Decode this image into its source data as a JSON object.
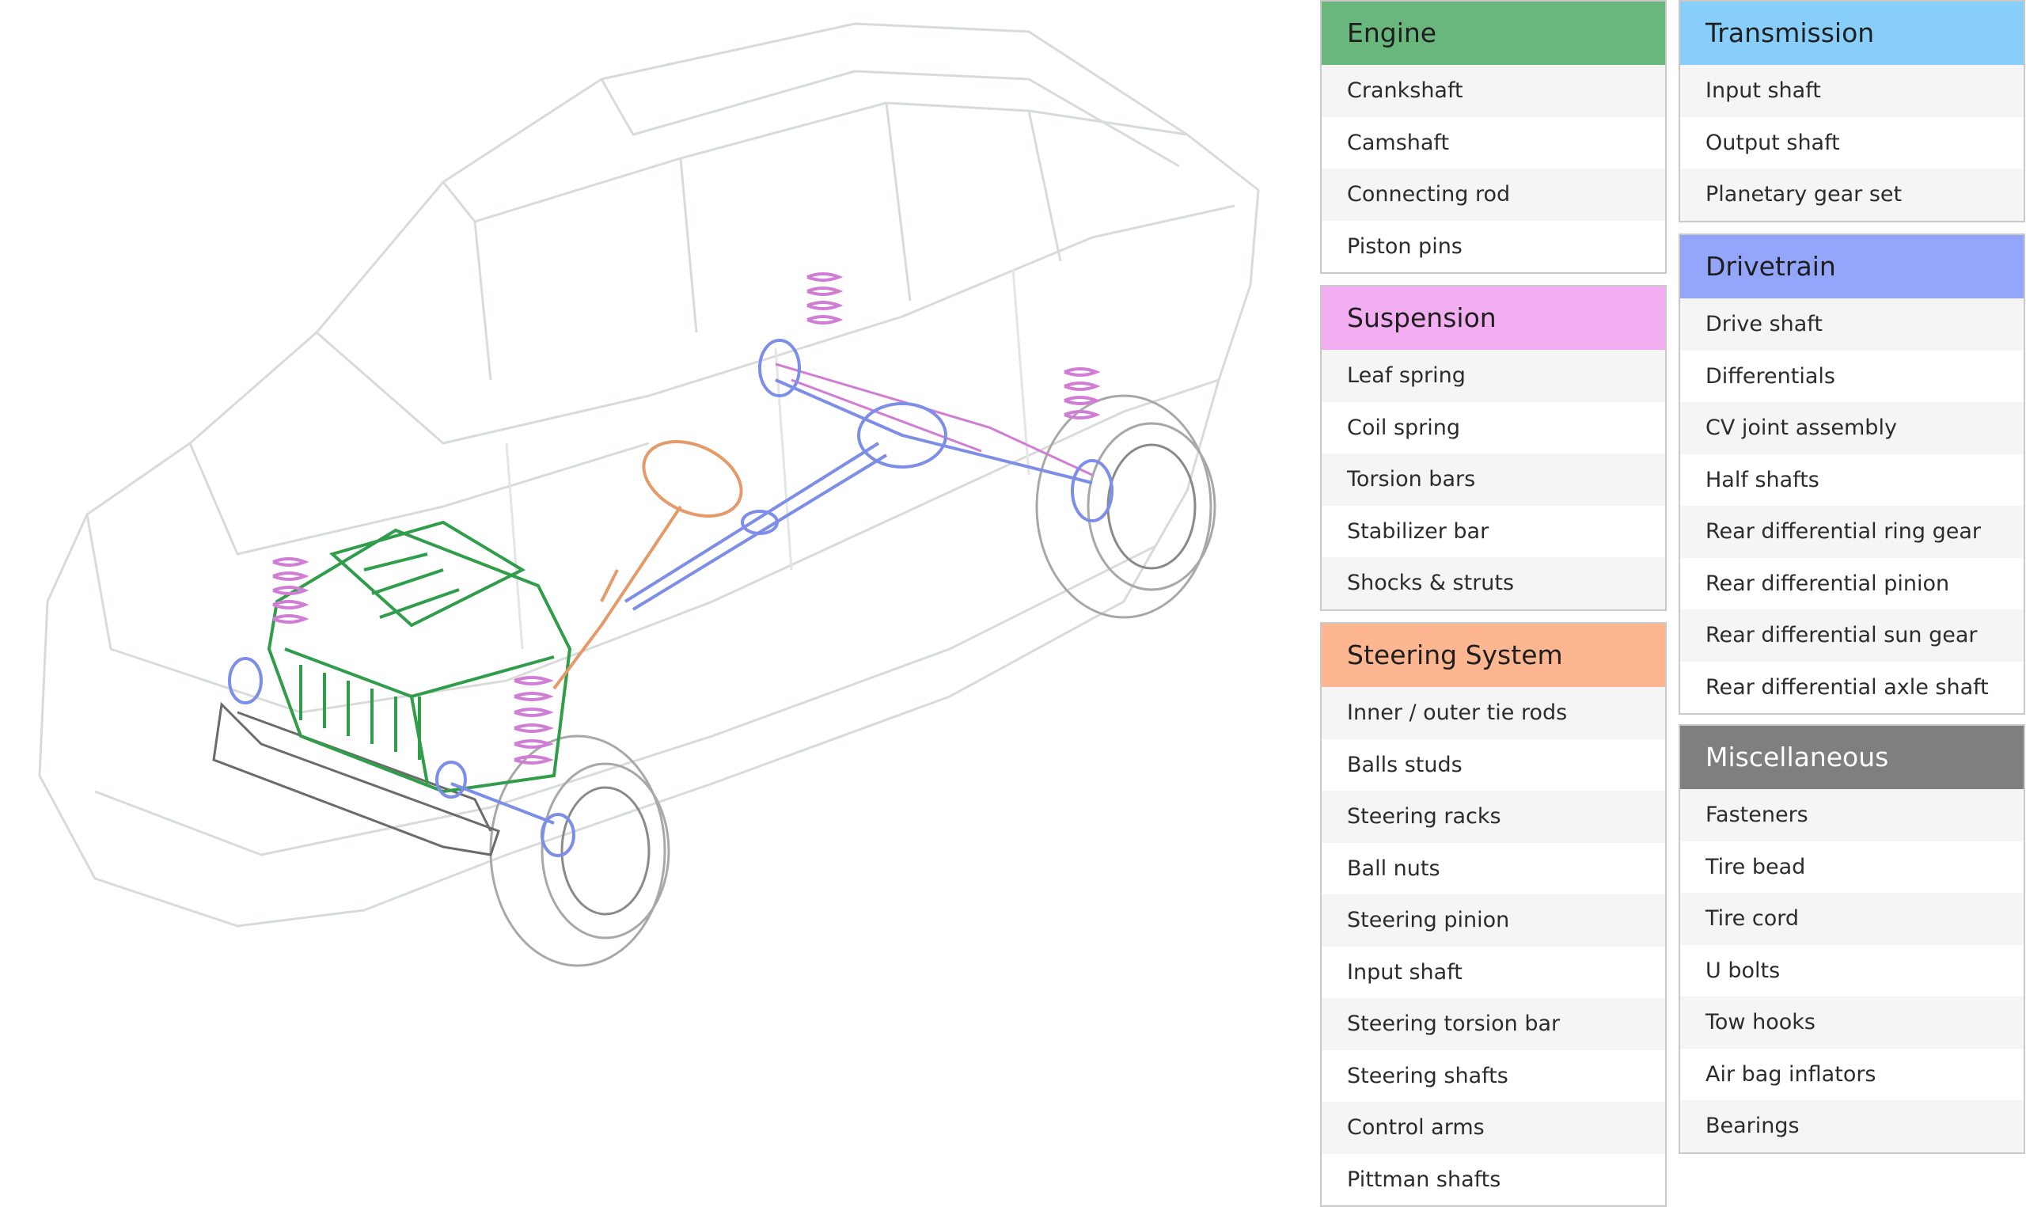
{
  "categories": {
    "engine": {
      "title": "Engine",
      "color": "#6ab77e",
      "items": [
        "Crankshaft",
        "Camshaft",
        "Connecting rod",
        "Piston pins"
      ]
    },
    "transmission": {
      "title": "Transmission",
      "color": "#87cffa",
      "items": [
        "Input shaft",
        "Output shaft",
        "Planetary gear set"
      ]
    },
    "suspension": {
      "title": "Suspension",
      "color": "#f3aef1",
      "items": [
        "Leaf spring",
        "Coil spring",
        "Torsion bars",
        "Stabilizer bar",
        "Shocks & struts"
      ]
    },
    "drivetrain": {
      "title": "Drivetrain",
      "color": "#93a6fb",
      "items": [
        "Drive shaft",
        "Differentials",
        "CV joint assembly",
        "Half shafts",
        "Rear differential ring gear",
        "Rear differential pinion",
        "Rear differential sun gear",
        "Rear differential axle shaft"
      ]
    },
    "steering": {
      "title": "Steering System",
      "color": "#fdb690",
      "items": [
        "Inner / outer tie rods",
        "Balls studs",
        "Steering racks",
        "Ball nuts",
        "Steering pinion",
        "Input shaft",
        "Steering torsion bar",
        "Steering shafts",
        "Control arms",
        "Pittman shafts"
      ]
    },
    "misc": {
      "title": "Miscellaneous",
      "color": "#7f7f7f",
      "title_color": "#ffffff",
      "items": [
        "Fasteners",
        "Tire bead",
        "Tire cord",
        "U bolts",
        "Tow hooks",
        "Air bag inflators",
        "Bearings"
      ]
    }
  }
}
